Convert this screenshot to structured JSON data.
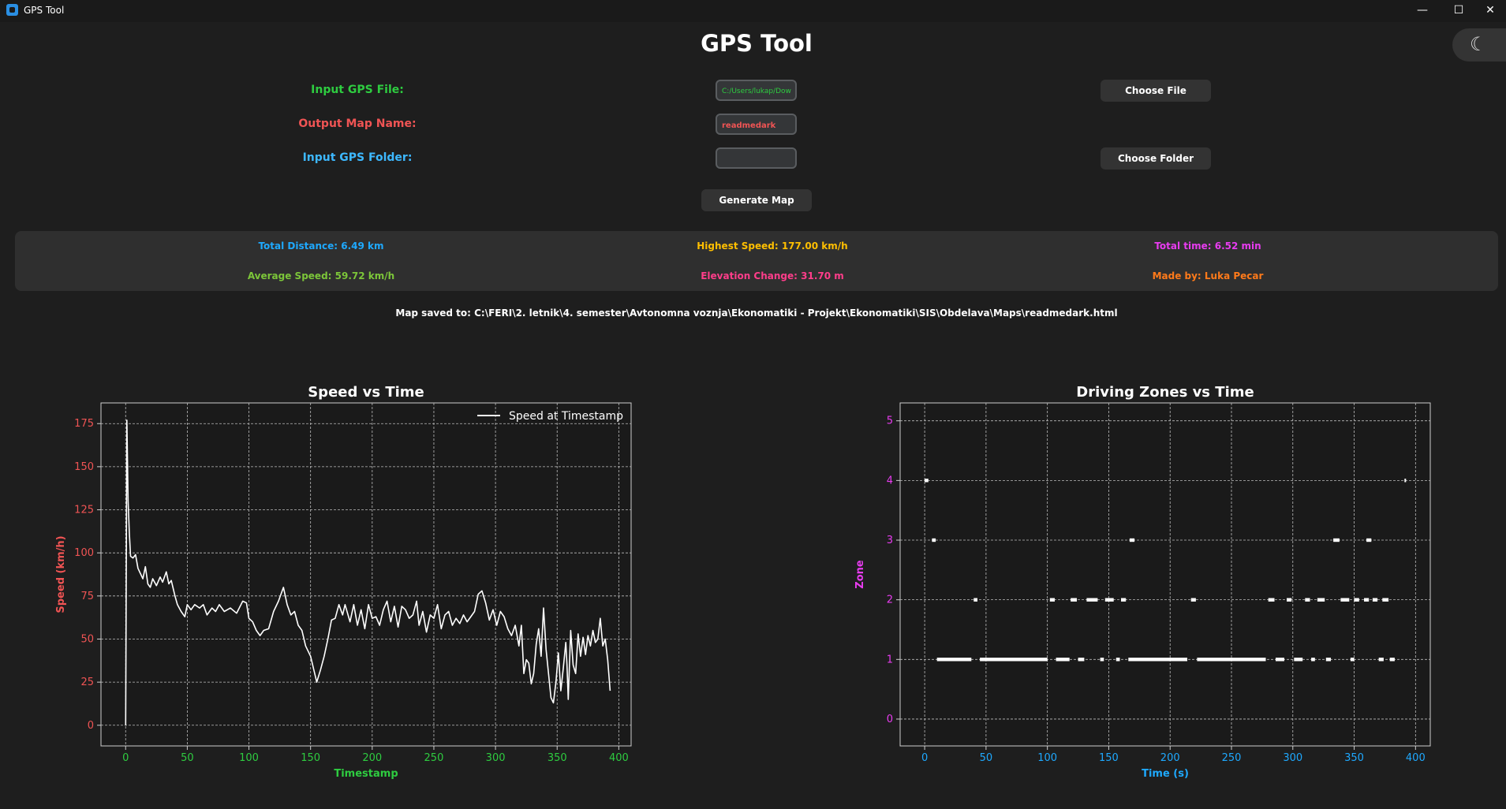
{
  "window": {
    "title": "GPS Tool",
    "icons": {
      "minimize": "minimize-icon",
      "maximize": "maximize-icon",
      "close": "close-icon",
      "theme": "moon-icon"
    }
  },
  "header": {
    "title": "GPS Tool"
  },
  "form": {
    "input_file_label": "Input GPS File:",
    "input_file_value": "C:/Users/lukap/Dow",
    "choose_file_label": "Choose File",
    "output_map_label": "Output Map Name:",
    "output_map_value": "readmedark",
    "input_folder_label": "Input GPS Folder:",
    "input_folder_value": "",
    "choose_folder_label": "Choose Folder",
    "generate_label": "Generate Map"
  },
  "stats": {
    "total_distance": "Total Distance: 6.49 km",
    "highest_speed": "Highest Speed: 177.00 km/h",
    "total_time": "Total time: 6.52 min",
    "average_speed": "Average Speed: 59.72 km/h",
    "elevation_change": "Elevation Change: 31.70 m",
    "made_by": "Made by: Luka Pecar"
  },
  "saved_message": "Map saved to: C:\\FERI\\2. letnik\\4. semester\\Avtonomna voznja\\Ekonomatiki - Projekt\\Ekonomatiki\\SIS\\Obdelava\\Maps\\readmedark.html",
  "colors": {
    "background": "#1e1e1e",
    "panel": "#2f2f2f",
    "green": "#2ecc40",
    "red": "#f05454",
    "blue": "#3db8ff",
    "speed_axis": "#f05454",
    "speed_x_axis": "#2ecc40",
    "zone_y_axis": "#e83cf0",
    "zone_x_axis": "#1ea9ff",
    "plot_bg": "#1a1a1a"
  },
  "chart_data": [
    {
      "type": "line",
      "title": "Speed vs Time",
      "xlabel": "Timestamp",
      "ylabel": "Speed (km/h)",
      "xlim": [
        -20,
        410
      ],
      "ylim": [
        -12,
        187
      ],
      "xticks": [
        "0",
        "50",
        "100",
        "150",
        "200",
        "250",
        "300",
        "350",
        "400"
      ],
      "yticks": [
        "0",
        "25",
        "50",
        "75",
        "100",
        "125",
        "150",
        "175"
      ],
      "grid": true,
      "legend": "top-right",
      "series": [
        {
          "name": "Speed at Timestamp",
          "points": [
            [
              0,
              0
            ],
            [
              1,
              177
            ],
            [
              2,
              130
            ],
            [
              3,
              112
            ],
            [
              4,
              98
            ],
            [
              6,
              97
            ],
            [
              8,
              99
            ],
            [
              10,
              91
            ],
            [
              12,
              88
            ],
            [
              14,
              85
            ],
            [
              16,
              92
            ],
            [
              18,
              82
            ],
            [
              20,
              80
            ],
            [
              22,
              85
            ],
            [
              25,
              81
            ],
            [
              28,
              86
            ],
            [
              30,
              83
            ],
            [
              33,
              89
            ],
            [
              35,
              82
            ],
            [
              37,
              84
            ],
            [
              40,
              75
            ],
            [
              42,
              70
            ],
            [
              45,
              66
            ],
            [
              48,
              63
            ],
            [
              50,
              70
            ],
            [
              53,
              67
            ],
            [
              56,
              70
            ],
            [
              60,
              68
            ],
            [
              63,
              70
            ],
            [
              66,
              64
            ],
            [
              70,
              68
            ],
            [
              73,
              66
            ],
            [
              76,
              70
            ],
            [
              80,
              66
            ],
            [
              85,
              68
            ],
            [
              90,
              65
            ],
            [
              95,
              72
            ],
            [
              98,
              71
            ],
            [
              100,
              62
            ],
            [
              103,
              60
            ],
            [
              106,
              55
            ],
            [
              109,
              52
            ],
            [
              112,
              55
            ],
            [
              116,
              56
            ],
            [
              120,
              66
            ],
            [
              124,
              72
            ],
            [
              128,
              80
            ],
            [
              131,
              70
            ],
            [
              134,
              64
            ],
            [
              137,
              66
            ],
            [
              140,
              58
            ],
            [
              143,
              55
            ],
            [
              146,
              46
            ],
            [
              150,
              40
            ],
            [
              153,
              31
            ],
            [
              155,
              25
            ],
            [
              158,
              32
            ],
            [
              161,
              40
            ],
            [
              164,
              50
            ],
            [
              167,
              61
            ],
            [
              170,
              62
            ],
            [
              173,
              70
            ],
            [
              176,
              64
            ],
            [
              178,
              70
            ],
            [
              182,
              60
            ],
            [
              185,
              70
            ],
            [
              188,
              58
            ],
            [
              191,
              67
            ],
            [
              194,
              56
            ],
            [
              197,
              70
            ],
            [
              200,
              62
            ],
            [
              203,
              63
            ],
            [
              206,
              58
            ],
            [
              209,
              67
            ],
            [
              212,
              72
            ],
            [
              215,
              60
            ],
            [
              218,
              69
            ],
            [
              221,
              57
            ],
            [
              224,
              69
            ],
            [
              227,
              67
            ],
            [
              230,
              62
            ],
            [
              233,
              64
            ],
            [
              236,
              72
            ],
            [
              238,
              58
            ],
            [
              241,
              66
            ],
            [
              244,
              54
            ],
            [
              247,
              64
            ],
            [
              250,
              62
            ],
            [
              253,
              70
            ],
            [
              256,
              56
            ],
            [
              259,
              64
            ],
            [
              262,
              66
            ],
            [
              265,
              58
            ],
            [
              268,
              62
            ],
            [
              271,
              59
            ],
            [
              274,
              64
            ],
            [
              277,
              60
            ],
            [
              280,
              63
            ],
            [
              283,
              66
            ],
            [
              286,
              76
            ],
            [
              289,
              78
            ],
            [
              292,
              71
            ],
            [
              295,
              61
            ],
            [
              298,
              67
            ],
            [
              301,
              58
            ],
            [
              304,
              66
            ],
            [
              307,
              63
            ],
            [
              310,
              56
            ],
            [
              313,
              52
            ],
            [
              316,
              58
            ],
            [
              319,
              46
            ],
            [
              321,
              58
            ],
            [
              323,
              30
            ],
            [
              325,
              38
            ],
            [
              327,
              36
            ],
            [
              329,
              24
            ],
            [
              331,
              30
            ],
            [
              333,
              47
            ],
            [
              335,
              56
            ],
            [
              337,
              40
            ],
            [
              339,
              68
            ],
            [
              341,
              44
            ],
            [
              343,
              30
            ],
            [
              345,
              16
            ],
            [
              347,
              13
            ],
            [
              349,
              25
            ],
            [
              351,
              42
            ],
            [
              353,
              20
            ],
            [
              355,
              33
            ],
            [
              357,
              48
            ],
            [
              358,
              35
            ],
            [
              359,
              15
            ],
            [
              361,
              55
            ],
            [
              363,
              35
            ],
            [
              365,
              30
            ],
            [
              367,
              53
            ],
            [
              369,
              40
            ],
            [
              371,
              51
            ],
            [
              373,
              41
            ],
            [
              375,
              52
            ],
            [
              377,
              46
            ],
            [
              379,
              55
            ],
            [
              381,
              48
            ],
            [
              383,
              50
            ],
            [
              385,
              62
            ],
            [
              387,
              46
            ],
            [
              389,
              50
            ],
            [
              391,
              38
            ],
            [
              393,
              20
            ]
          ]
        }
      ]
    },
    {
      "type": "scatter",
      "title": "Driving Zones vs Time",
      "xlabel": "Time (s)",
      "ylabel": "Zone",
      "xlim": [
        -20,
        412
      ],
      "ylim": [
        -0.45,
        5.3
      ],
      "xticks": [
        "0",
        "50",
        "100",
        "150",
        "200",
        "250",
        "300",
        "350",
        "400"
      ],
      "yticks": [
        "0",
        "1",
        "2",
        "3",
        "4",
        "5"
      ],
      "grid": true,
      "zone_segments": [
        {
          "zone": 4,
          "t0": 0,
          "t1": 3
        },
        {
          "zone": 4,
          "t0": 391,
          "t1": 392
        },
        {
          "zone": 3,
          "t0": 6,
          "t1": 9
        },
        {
          "zone": 3,
          "t0": 167,
          "t1": 171
        },
        {
          "zone": 3,
          "t0": 333,
          "t1": 338
        },
        {
          "zone": 3,
          "t0": 360,
          "t1": 364
        },
        {
          "zone": 2,
          "t0": 40,
          "t1": 43
        },
        {
          "zone": 2,
          "t0": 102,
          "t1": 106
        },
        {
          "zone": 2,
          "t0": 119,
          "t1": 124
        },
        {
          "zone": 2,
          "t0": 132,
          "t1": 141
        },
        {
          "zone": 2,
          "t0": 147,
          "t1": 154
        },
        {
          "zone": 2,
          "t0": 160,
          "t1": 164
        },
        {
          "zone": 2,
          "t0": 217,
          "t1": 221
        },
        {
          "zone": 2,
          "t0": 280,
          "t1": 285
        },
        {
          "zone": 2,
          "t0": 295,
          "t1": 299
        },
        {
          "zone": 2,
          "t0": 310,
          "t1": 314
        },
        {
          "zone": 2,
          "t0": 320,
          "t1": 326
        },
        {
          "zone": 2,
          "t0": 339,
          "t1": 346
        },
        {
          "zone": 2,
          "t0": 350,
          "t1": 354
        },
        {
          "zone": 2,
          "t0": 358,
          "t1": 362
        },
        {
          "zone": 2,
          "t0": 365,
          "t1": 369
        },
        {
          "zone": 2,
          "t0": 373,
          "t1": 378
        },
        {
          "zone": 1,
          "t0": 10,
          "t1": 38
        },
        {
          "zone": 1,
          "t0": 45,
          "t1": 100
        },
        {
          "zone": 1,
          "t0": 107,
          "t1": 118
        },
        {
          "zone": 1,
          "t0": 125,
          "t1": 130
        },
        {
          "zone": 1,
          "t0": 143,
          "t1": 146
        },
        {
          "zone": 1,
          "t0": 156,
          "t1": 159
        },
        {
          "zone": 1,
          "t0": 166,
          "t1": 214
        },
        {
          "zone": 1,
          "t0": 222,
          "t1": 278
        },
        {
          "zone": 1,
          "t0": 286,
          "t1": 293
        },
        {
          "zone": 1,
          "t0": 301,
          "t1": 308
        },
        {
          "zone": 1,
          "t0": 315,
          "t1": 318
        },
        {
          "zone": 1,
          "t0": 327,
          "t1": 331
        },
        {
          "zone": 1,
          "t0": 347,
          "t1": 350
        },
        {
          "zone": 1,
          "t0": 370,
          "t1": 374
        },
        {
          "zone": 1,
          "t0": 379,
          "t1": 383
        }
      ]
    }
  ]
}
